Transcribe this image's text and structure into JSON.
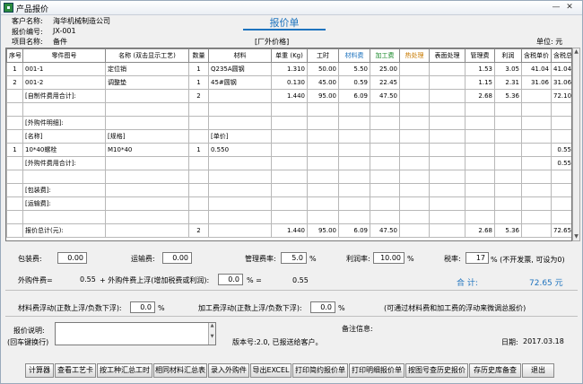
{
  "window": {
    "title": "产品报价",
    "minimize": "—",
    "restore": "□",
    "close": "✕"
  },
  "header": {
    "customer_label": "客户名称:",
    "customer_value": "海华机械制造公司",
    "quote_no_label": "报价编号:",
    "quote_no_value": "JX-001",
    "project_label": "项目名称:",
    "project_value": "备件",
    "report_title": "报价单",
    "price_type": "[厂外价格]",
    "unit_label": "单位: 元"
  },
  "table": {
    "columns": [
      "序号",
      "零件图号",
      "名称 (双击显示工艺)",
      "数量",
      "材料",
      "单重 (Kg)",
      "工时",
      "材料费",
      "加工费",
      "热处理",
      "表面处理",
      "管理费",
      "利润",
      "含税单价",
      "含税总价"
    ],
    "rows": [
      [
        "1",
        "001-1",
        "定位销",
        "1",
        "Q235A圆钢",
        "1.310",
        "50.00",
        "5.50",
        "25.00",
        "",
        "",
        "1.53",
        "3.05",
        "41.04",
        "41.04"
      ],
      [
        "2",
        "001-2",
        "调整垫",
        "1",
        "45#圆钢",
        "0.130",
        "45.00",
        "0.59",
        "22.45",
        "",
        "",
        "1.15",
        "2.31",
        "31.06",
        "31.06"
      ],
      [
        "",
        "[自制件费用合计]:",
        "",
        "2",
        "",
        "1.440",
        "95.00",
        "6.09",
        "47.50",
        "",
        "",
        "2.68",
        "5.36",
        "",
        "72.10"
      ],
      [
        "",
        "",
        "",
        "",
        "",
        "",
        "",
        "",
        "",
        "",
        "",
        "",
        "",
        "",
        ""
      ],
      [
        "",
        "[外购件明细]:",
        "",
        "",
        "",
        "",
        "",
        "",
        "",
        "",
        "",
        "",
        "",
        "",
        ""
      ],
      [
        "",
        "[名称]",
        "[规格]",
        "",
        "[单价]",
        "",
        "",
        "",
        "",
        "",
        "",
        "",
        "",
        "",
        ""
      ],
      [
        "1",
        "10*40螺栓",
        "M10*40",
        "1",
        "0.550",
        "",
        "",
        "",
        "",
        "",
        "",
        "",
        "",
        "",
        "0.55"
      ],
      [
        "",
        "[外购件费用合计]:",
        "",
        "",
        "",
        "",
        "",
        "",
        "",
        "",
        "",
        "",
        "",
        "",
        "0.55"
      ],
      [
        "",
        "",
        "",
        "",
        "",
        "",
        "",
        "",
        "",
        "",
        "",
        "",
        "",
        "",
        ""
      ],
      [
        "",
        "[包装费]:",
        "",
        "",
        "",
        "",
        "",
        "",
        "",
        "",
        "",
        "",
        "",
        "",
        ""
      ],
      [
        "",
        "[运输费]:",
        "",
        "",
        "",
        "",
        "",
        "",
        "",
        "",
        "",
        "",
        "",
        "",
        ""
      ],
      [
        "",
        "",
        "",
        "",
        "",
        "",
        "",
        "",
        "",
        "",
        "",
        "",
        "",
        "",
        ""
      ],
      [
        "",
        "报价总计(元):",
        "",
        "2",
        "",
        "1.440",
        "95.00",
        "6.09",
        "47.50",
        "",
        "",
        "2.68",
        "5.36",
        "",
        "72.65"
      ]
    ]
  },
  "form": {
    "packaging_label": "包装费:",
    "packaging_value": "0.00",
    "transport_label": "运输费:",
    "transport_value": "0.00",
    "mgmt_rate_label": "管理费率:",
    "mgmt_rate_value": "5.0",
    "pct": "%",
    "profit_rate_label": "利润率:",
    "profit_rate_value": "10.00",
    "tax_rate_label": "税率:",
    "tax_rate_value": "17",
    "tax_note": "% (不开发票, 可设为0)",
    "outsourced_label": "外购件费=",
    "outsourced_value": "0.55",
    "outsourced_float_label": "+ 外购件费上浮(增加税费或利润):",
    "outsourced_float_value": "0.0",
    "equals": "% =",
    "outsourced_result": "0.55",
    "total_label": "合 计:",
    "total_value": "72.65 元",
    "mat_float_label": "材料费浮动(正数上浮/负数下浮):",
    "mat_float_value": "0.0",
    "proc_float_label": "加工费浮动(正数上浮/负数下浮):",
    "proc_float_value": "0.0",
    "float_note": "(可通过材料费和加工费的浮动来微调总报价)",
    "quote_note_label": "报价说明:",
    "quote_note_hint": "(回车键换行)",
    "remark_label": "备注信息:",
    "version_text": "版本号:2.0, 已报送给客户。",
    "date_label": "日期:",
    "date_value": "2017.03.18"
  },
  "buttons": [
    "计算器",
    "查看工艺卡",
    "按工种汇总工时",
    "相同材料汇总表",
    "录入外购件",
    "导出EXCEL",
    "打印简约报价单",
    "打印明细报价单",
    "按图号查历史报价",
    "存历史库备查",
    "退出"
  ],
  "colors": {
    "accent": "#1e73be",
    "material_fee": "#1e73be",
    "processing_fee": "#1b8a2b",
    "heat_treatment": "#c87a00"
  }
}
